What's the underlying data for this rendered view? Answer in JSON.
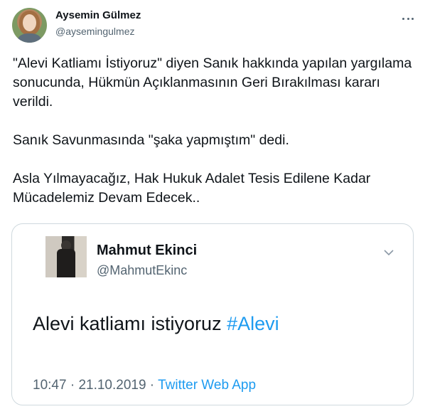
{
  "tweet": {
    "author_name": "Aysemin Gülmez",
    "author_handle": "@aysemingulmez",
    "more_icon": "more-horizontal-icon",
    "paragraphs": [
      "\"Alevi Katliamı İstiyoruz\" diyen Sanık hakkında yapılan yargılama sonucunda, Hükmün Açıklanmasının Geri Bırakılması kararı verildi.",
      "Sanık Savunmasında \"şaka yapmıştım\" dedi.",
      "Asla Yılmayacağız, Hak Hukuk Adalet Tesis Edilene Kadar Mücadelemiz Devam Edecek.."
    ]
  },
  "quoted_tweet": {
    "author_name": "Mahmut Ekinci",
    "author_handle": "@MahmutEkinc",
    "chevron_icon": "chevron-down-icon",
    "text": "Alevi katliamı istiyoruz ",
    "hashtag": "#Alevi",
    "time": "10:47",
    "separator": " · ",
    "date": "21.10.2019",
    "source": "Twitter Web App"
  },
  "colors": {
    "text": "#0f1419",
    "secondary": "#536471",
    "link": "#1d9bf0",
    "border": "#cfd9de"
  }
}
